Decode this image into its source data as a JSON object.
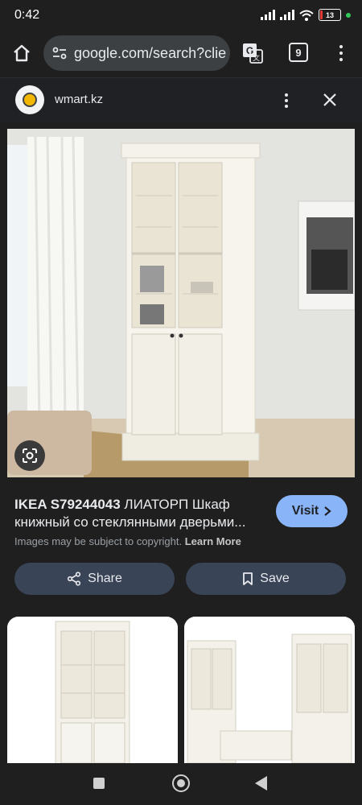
{
  "status_bar": {
    "time": "0:42",
    "battery": "13",
    "battery_level": 0.13
  },
  "browser": {
    "url": "google.com/search?clie",
    "tab_count": "9"
  },
  "site": {
    "name": "wmart.kz"
  },
  "result": {
    "brand": "IKEA S79244043",
    "title_rest": " ЛИАТОРП Шкаф книжный со стеклянными дверьми...",
    "visit_label": "Visit",
    "copyright_text": "Images may be subject to copyright.",
    "learn_more": "Learn More"
  },
  "actions": {
    "share_label": "Share",
    "save_label": "Save"
  },
  "colors": {
    "accent": "#8ab4f8",
    "chip_bg": "#394457",
    "background": "#1f1f1f"
  },
  "icons": [
    "home-icon",
    "site-info-icon",
    "translate-icon",
    "tabs-icon",
    "more-vert-icon",
    "close-icon",
    "lens-icon",
    "share-icon",
    "bookmark-icon",
    "chevron-right-icon"
  ]
}
